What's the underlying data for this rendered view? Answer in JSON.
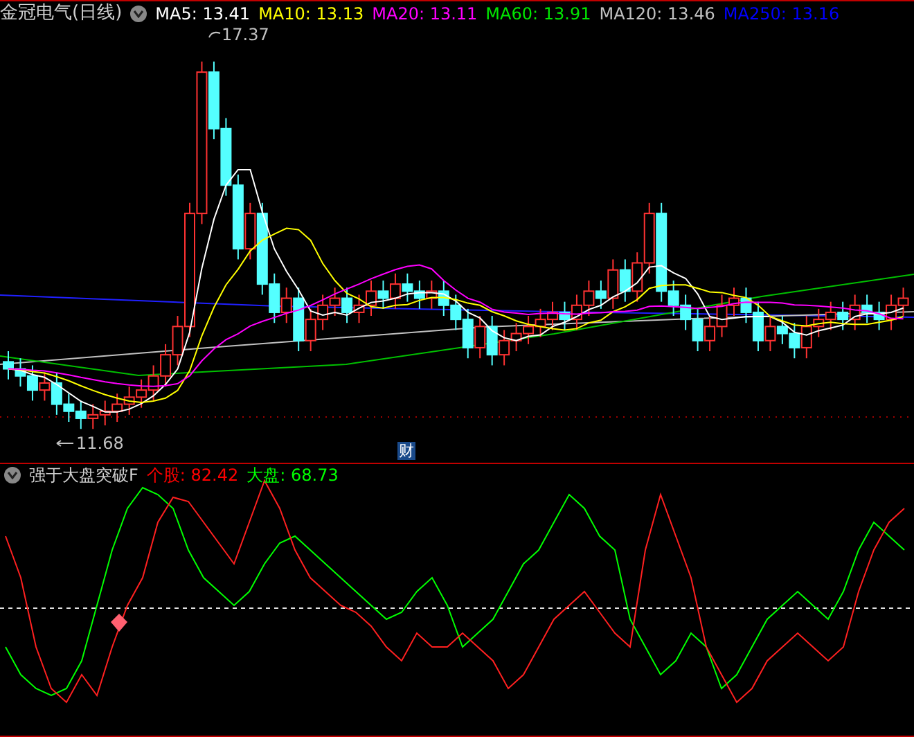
{
  "main_panel": {
    "title": "金冠电气(日线)",
    "ma_legend": [
      {
        "label": "MA5: 13.41",
        "color": "#ffffff"
      },
      {
        "label": "MA10: 13.13",
        "color": "#ffff00"
      },
      {
        "label": "MA20: 13.11",
        "color": "#ff00ff"
      },
      {
        "label": "MA60: 13.91",
        "color": "#00e600"
      },
      {
        "label": "MA120: 13.46",
        "color": "#c0c0c0"
      },
      {
        "label": "MA250: 13.16",
        "color": "#0000ff"
      }
    ],
    "high_label": "17.37",
    "low_label": "11.68",
    "badge": "财"
  },
  "indicator_panel": {
    "title": "强于大盘突破F",
    "legend": [
      {
        "label": "个股: 82.42",
        "color": "#ff0000"
      },
      {
        "label": "大盘: 68.73",
        "color": "#00ff00"
      }
    ]
  }
}
